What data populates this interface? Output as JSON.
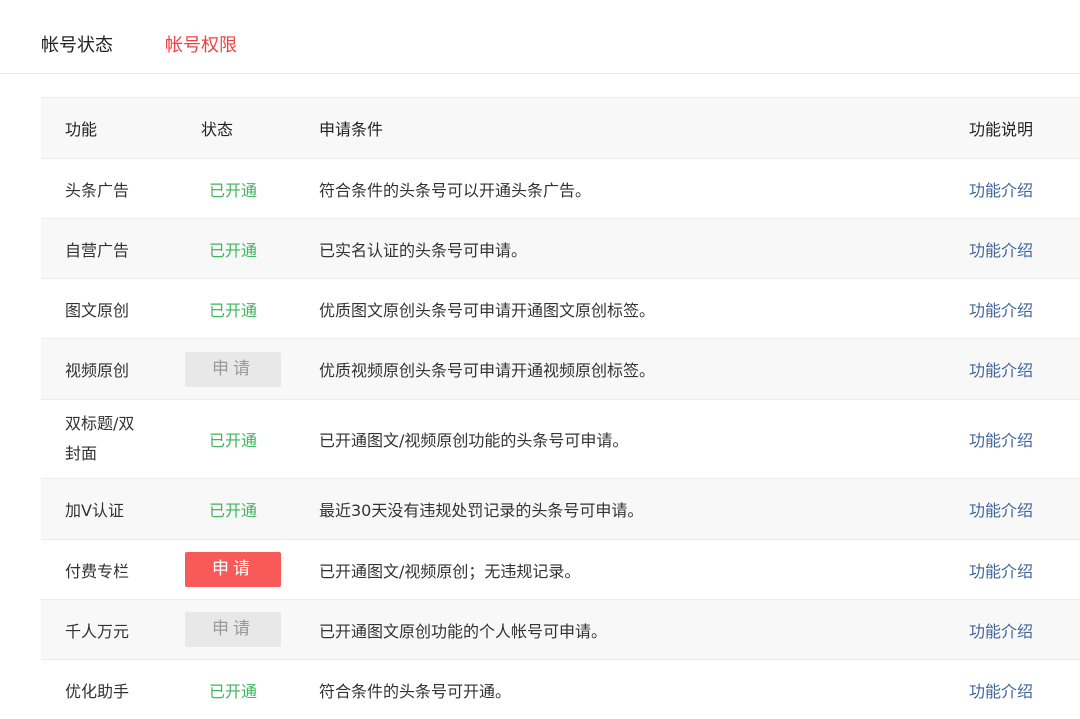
{
  "tabs": [
    {
      "label": "帐号状态"
    },
    {
      "label": "帐号权限"
    }
  ],
  "table": {
    "headers": {
      "func": "功能",
      "status": "状态",
      "cond": "申请条件",
      "desc": "功能说明"
    },
    "rows": [
      {
        "func": "头条广告",
        "status": "已开通",
        "cond": "符合条件的头条号可以开通头条广告。",
        "link": "功能介绍"
      },
      {
        "func": "自营广告",
        "status": "已开通",
        "cond": "已实名认证的头条号可申请。",
        "link": "功能介绍"
      },
      {
        "func": "图文原创",
        "status": "已开通",
        "cond": "优质图文原创头条号可申请开通图文原创标签。",
        "link": "功能介绍"
      },
      {
        "func": "视频原创",
        "status": "申请",
        "cond": "优质视频原创头条号可申请开通视频原创标签。",
        "link": "功能介绍"
      },
      {
        "func_line1": "双标题/双",
        "func_line2": "封面",
        "status": "已开通",
        "cond": "已开通图文/视频原创功能的头条号可申请。",
        "link": "功能介绍"
      },
      {
        "func": "加V认证",
        "status": "已开通",
        "cond": "最近30天没有违规处罚记录的头条号可申请。",
        "link": "功能介绍"
      },
      {
        "func": "付费专栏",
        "status": "申请",
        "cond": "已开通图文/视频原创；无违规记录。",
        "link": "功能介绍"
      },
      {
        "func": "千人万元",
        "status": "申请",
        "cond": "已开通图文原创功能的个人帐号可申请。",
        "link": "功能介绍"
      },
      {
        "func": "优化助手",
        "status": "已开通",
        "cond": "符合条件的头条号可开通。",
        "link": "功能介绍"
      }
    ]
  },
  "colors": {
    "accent_red": "#f04142",
    "status_green": "#3fb65f",
    "apply_button_red": "#f85959",
    "disabled_button_gray": "#e8e8e8",
    "link_blue": "#406599",
    "row_alt_bg": "#f8f8f8"
  }
}
